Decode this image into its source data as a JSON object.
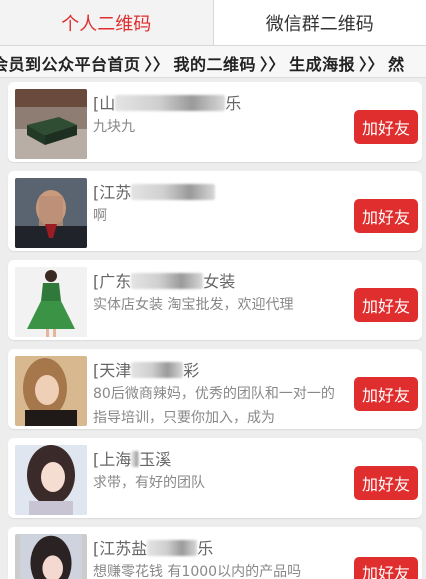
{
  "tabs": [
    {
      "label": "个人二维码",
      "active": true
    },
    {
      "label": "微信群二维码",
      "active": false
    }
  ],
  "breadcrumbs": [
    "会员到公众平台首页",
    "我的二维码",
    "生成海报",
    "然"
  ],
  "add_label": "加好友",
  "colors": {
    "accent": "#e02e2e",
    "background": "#ededed"
  },
  "items": [
    {
      "name_prefix": "[山",
      "name_suffix": "乐",
      "desc": "九块九"
    },
    {
      "name_prefix": "[江苏",
      "name_suffix": "",
      "desc": "啊"
    },
    {
      "name_prefix": "[广东",
      "name_suffix": "女装",
      "desc": "实体店女装 淘宝批发，欢迎代理"
    },
    {
      "name_prefix": "[天津",
      "name_suffix": "彩",
      "desc": "80后微商辣妈，优秀的团队和一对一的指导培训，只要你加入，成为"
    },
    {
      "name_prefix": "[上海",
      "name_suffix": "玉溪",
      "desc": "求带，有好的团队"
    },
    {
      "name_prefix": "[江苏盐",
      "name_suffix": "乐",
      "desc": "想赚零花钱 有1000以内的产品吗"
    }
  ]
}
